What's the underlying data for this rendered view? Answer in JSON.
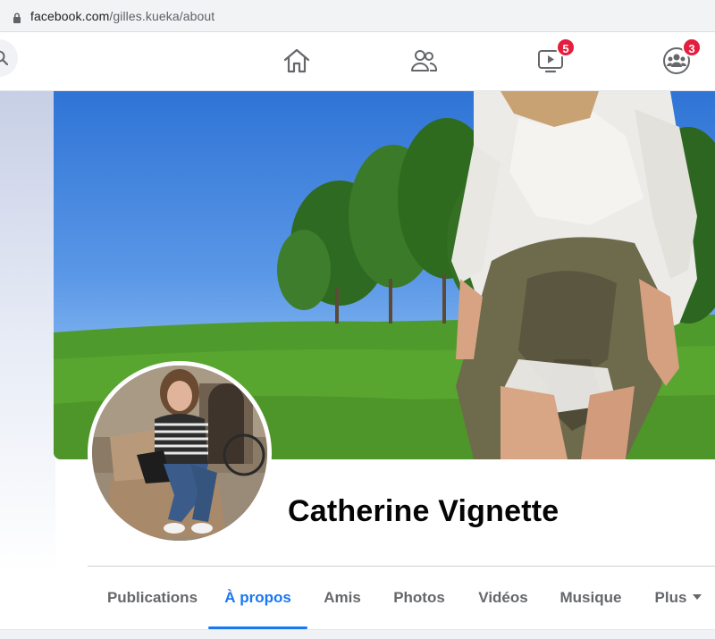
{
  "browser": {
    "url_domain": "facebook.com",
    "url_path": "/gilles.kueka/about"
  },
  "nav": {
    "watch_badge": "5",
    "groups_badge": "3"
  },
  "profile": {
    "name": "Catherine Vignette"
  },
  "tabs": [
    {
      "label": "Publications"
    },
    {
      "label": "À propos"
    },
    {
      "label": "Amis"
    },
    {
      "label": "Photos"
    },
    {
      "label": "Vidéos"
    },
    {
      "label": "Musique"
    },
    {
      "label": "Plus"
    }
  ],
  "icons": {
    "lock": "lock-icon",
    "search": "search-icon",
    "home": "home-icon",
    "friends": "friends-icon",
    "watch": "watch-icon",
    "groups": "groups-icon",
    "more": "caret-down-icon"
  },
  "colors": {
    "accent": "#1877f2",
    "badge": "#e41e3f",
    "tab_inactive": "#65676b"
  },
  "active_tab": "À propos"
}
